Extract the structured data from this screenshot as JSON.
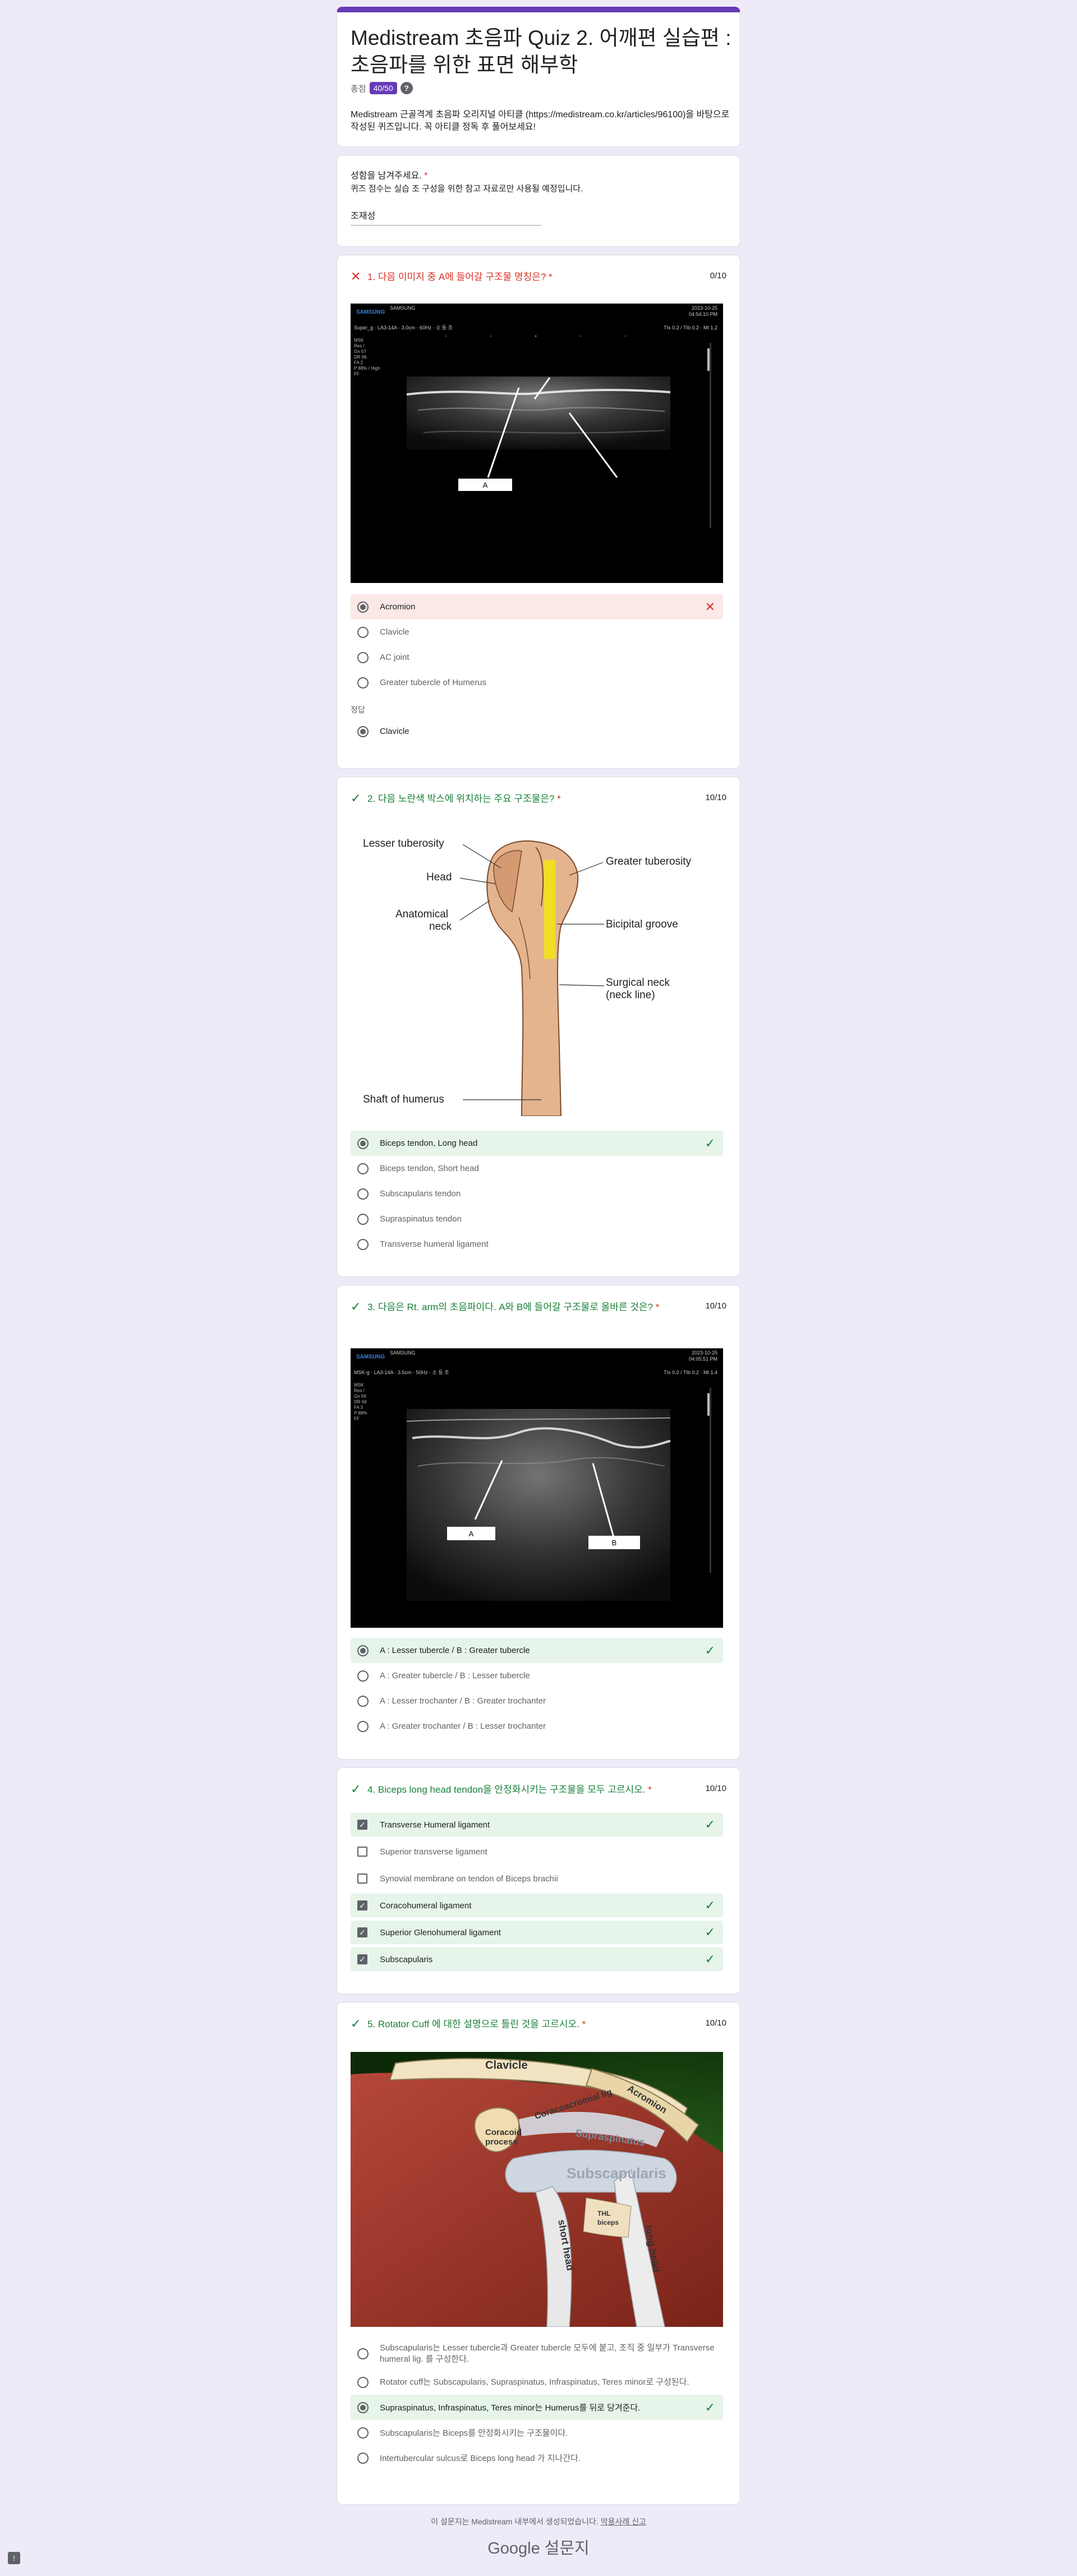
{
  "form": {
    "title": "Medistream 초음파 Quiz 2. 어깨편 실습편 : 초음파를 위한 표면 해부학",
    "total_label": "총점",
    "total_score": "40/50",
    "help_glyph": "?",
    "description": "Medistream 근골격계 초음파 오리지널 아티클 (https://medistream.co.kr/articles/96100)을 바탕으로 작성된 퀴즈입니다. 꼭 아티클 정독 후 풀어보세요!"
  },
  "name_question": {
    "label": "성함을 남겨주세요.",
    "required": "*",
    "description": "퀴즈 점수는 실습 조 구성을 위한 참고 자료로만 사용될 예정입니다.",
    "answer": "조재성"
  },
  "questions": [
    {
      "title": "1. 다음 이미지 중 A에 들어갈 구조물 명칭은?",
      "required": "*",
      "score": "0/10",
      "status": "wrong",
      "image": {
        "brand": "SAMSUNG",
        "brand_small": "SAMSUNG",
        "date": "2023-10-25",
        "time": "04:54:10 PM",
        "probe": "Super_g · LA3-14A · 3.0cm · 60Hz · 소 등 조",
        "ti": "TIs  0.2 / TIb  0.2 · MI  1.2",
        "params": [
          "MSK",
          "Res /",
          "Gn  57",
          "DR  66",
          "FA  2",
          "P    88% / High",
          "FF  "
        ],
        "label_a": "A"
      },
      "options": [
        {
          "label": "Acromion",
          "selected": true,
          "mark": "✕"
        },
        {
          "label": "Clavicle",
          "selected": false
        },
        {
          "label": "AC joint",
          "selected": false
        },
        {
          "label": "Greater tubercle of Humerus",
          "selected": false
        }
      ],
      "correct_label": "정답",
      "correct_answer": "Clavicle"
    },
    {
      "title": "2. 다음 노란색 박스에 위치하는 주요 구조물은?",
      "required": "*",
      "score": "10/10",
      "status": "right",
      "diagram_labels": {
        "lesser": "Lesser tuberosity",
        "head": "Head",
        "anat1": "Anatomical",
        "anat2": "neck",
        "greater": "Greater tuberosity",
        "bicipital": "Bicipital groove",
        "surg1": "Surgical neck",
        "surg2": "(neck line)",
        "shaft": "Shaft of humerus"
      },
      "options": [
        {
          "label": "Biceps tendon, Long head",
          "selected": true,
          "mark": "✓"
        },
        {
          "label": "Biceps tendon, Short head",
          "selected": false
        },
        {
          "label": "Subscapularis tendon",
          "selected": false
        },
        {
          "label": "Supraspinatus tendon",
          "selected": false
        },
        {
          "label": "Transverse humeral ligament",
          "selected": false
        }
      ]
    },
    {
      "title": "3. 다음은 Rt. arm의 초음파이다. A와 B에 들어갈 구조물로 올바른 것은?",
      "required": "*",
      "score": "10/10",
      "status": "right",
      "image": {
        "brand": "SAMSUNG",
        "brand_small": "SAMSUNG",
        "date": "2023-10-25",
        "time": "04:05:51 PM",
        "probe": "MSK-g · LA3-14A · 3.5cm · 50Hz · 소 등 조",
        "ti": "TIs  0.2 / TIb  0.2 · MI  1.4",
        "params": [
          "MSK",
          "Res /",
          "Gn  56",
          "DR  66",
          "FA  3",
          "P    88%",
          "FF  "
        ],
        "label_a": "A",
        "label_b": "B"
      },
      "options": [
        {
          "label": "A : Lesser tubercle / B : Greater tubercle",
          "selected": true,
          "mark": "✓"
        },
        {
          "label": "A : Greater tubercle / B : Lesser tubercle",
          "selected": false
        },
        {
          "label": "A : Lesser trochanter / B : Greater trochanter",
          "selected": false
        },
        {
          "label": "A : Greater trochanter / B : Lesser trochanter",
          "selected": false
        }
      ]
    },
    {
      "title": "4. Biceps long head tendon을 안정화시키는 구조물을 모두 고르시오.",
      "required": "*",
      "score": "10/10",
      "status": "right",
      "options": [
        {
          "label": "Transverse Humeral ligament",
          "selected": true,
          "mark": "✓"
        },
        {
          "label": "Superior transverse ligament",
          "selected": false
        },
        {
          "label": "Synovial membrane on tendon of Biceps brachii",
          "selected": false
        },
        {
          "label": "Coracohumeral ligament",
          "selected": true,
          "mark": "✓"
        },
        {
          "label": "Superior Glenohumeral ligament",
          "selected": true,
          "mark": "✓"
        },
        {
          "label": "Subscapularis",
          "selected": true,
          "mark": "✓"
        }
      ]
    },
    {
      "title": "5. Rotator Cuff 에 대한 설명으로 틀린 것을 고르시오.",
      "required": "*",
      "score": "10/10",
      "status": "right",
      "anatomy_labels": {
        "clavicle": "Clavicle",
        "acromion": "Acromion",
        "coracoacromial": "Coracoacromial lig",
        "coracoid1": "Coracoid",
        "coracoid2": "process",
        "supraspinatus": "Supraspinatus",
        "subscapularis": "Subscapularis",
        "long_head": "long head",
        "short_head": "short head",
        "thl": "THL",
        "biceps": "biceps"
      },
      "options": [
        {
          "label": "Subscapularis는 Lesser tubercle과 Greater tubercle 모두에 붙고, 조직 중 일부가 Transverse humeral lig. 를 구성한다.",
          "selected": false
        },
        {
          "label": "Rotator cuff는 Subscapularis, Supraspinatus, Infraspinatus, Teres minor로 구성된다.",
          "selected": false
        },
        {
          "label": "Supraspinatus, Infraspinatus, Teres minor는 Humerus를 뒤로 당겨준다.",
          "selected": true,
          "mark": "✓"
        },
        {
          "label": "Subscapularis는 Biceps를 안정화시키는 구조물이다.",
          "selected": false
        },
        {
          "label": "Intertubercular sulcus로 Biceps long head 가 지나간다.",
          "selected": false
        }
      ]
    }
  ],
  "footer": {
    "text": "이 설문지는 Medistream 내부에서 생성되었습니다.",
    "report_link": "악용사례 신고",
    "logo": "Google 설문지"
  },
  "colors": {
    "accent": "#673ab7",
    "correct": "#188038",
    "wrong": "#d93025",
    "correct_bg": "#e6f4ea",
    "wrong_bg": "#fce8e6"
  }
}
